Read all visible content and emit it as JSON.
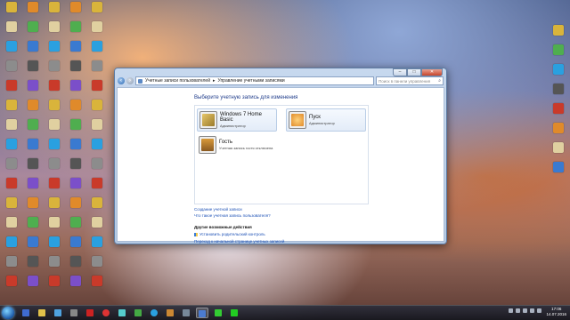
{
  "window": {
    "breadcrumb": [
      "Учетные записи пользователей",
      "Управление учетными записями"
    ],
    "search_placeholder": "Поиск в панели управления",
    "heading": "Выберите учетную запись для изменения",
    "accounts": [
      {
        "name": "Windows 7 Home Basic",
        "role": "Администратор",
        "color": "#c8a24a"
      },
      {
        "name": "Пуск",
        "role": "Администратор",
        "color": "#e39a3a"
      },
      {
        "name": "Гость",
        "role": "Учетная запись гостя отключена",
        "color": "#b6823a"
      }
    ],
    "links": {
      "create": "Создание учетной записи",
      "what_is": "Что такое учетная запись пользователя?"
    },
    "additional_title": "Другие возможные действия",
    "additional": {
      "parental": "Установить родительский контроль",
      "main_page": "Переход к начальной странице учетных записей"
    }
  },
  "taskbar": {
    "time": "17:06",
    "date": "14.07.2016"
  }
}
